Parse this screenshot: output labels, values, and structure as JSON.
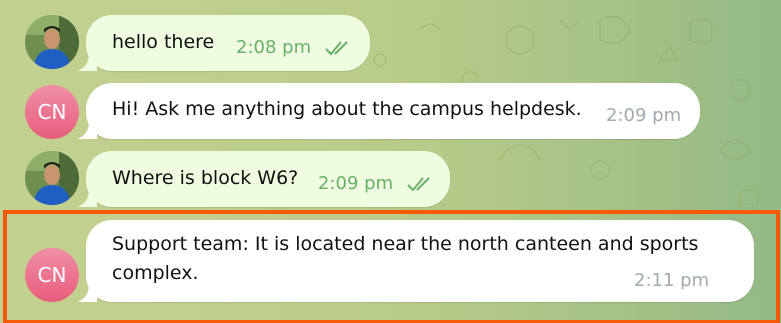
{
  "messages": [
    {
      "sender": "user",
      "avatar": "user-photo",
      "text": "hello there",
      "time": "2:08 pm",
      "status": "read-double-check-icon"
    },
    {
      "sender": "bot",
      "avatar_initials": "CN",
      "text": "Hi! Ask me anything about the campus helpdesk.",
      "time": "2:09 pm"
    },
    {
      "sender": "user",
      "avatar": "user-photo",
      "text": "Where is block W6?",
      "time": "2:09 pm",
      "status": "read-double-check-icon"
    },
    {
      "sender": "bot",
      "avatar_initials": "CN",
      "text_line1": "Support team: It is located near the north canteen and sports",
      "text_line2": "complex.",
      "time": "2:11 pm"
    }
  ],
  "colors": {
    "outgoing_bubble": "#effcdf",
    "incoming_bubble": "#ffffff",
    "outgoing_time": "#6ab06d",
    "incoming_time": "#a2a9af",
    "highlight_border": "#f45a08",
    "bot_avatar": "#e85d7d"
  }
}
